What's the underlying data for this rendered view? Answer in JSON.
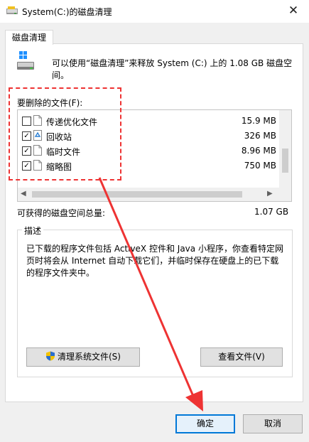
{
  "window": {
    "title": "System(C:)的磁盘清理",
    "close_glyph": "✕"
  },
  "tab": {
    "label": "磁盘清理"
  },
  "intro": {
    "text": "可以使用“磁盘清理”来释放 System (C:) 上的 1.08 GB 磁盘空间。"
  },
  "files": {
    "label": "要删除的文件(F):",
    "items": [
      {
        "name": "传递优化文件",
        "size": "15.9 MB",
        "checked": false,
        "icon": "file-icon"
      },
      {
        "name": "回收站",
        "size": "326 MB",
        "checked": true,
        "icon": "recycle-bin-icon"
      },
      {
        "name": "临时文件",
        "size": "8.96 MB",
        "checked": true,
        "icon": "file-icon"
      },
      {
        "name": "缩略图",
        "size": "750 MB",
        "checked": true,
        "icon": "file-icon"
      }
    ]
  },
  "total": {
    "label": "可获得的磁盘空间总量:",
    "value": "1.07 GB"
  },
  "description": {
    "title": "描述",
    "text": "已下载的程序文件包括 ActiveX 控件和 Java 小程序，你查看特定网页时将会从 Internet 自动下载它们，并临时保存在硬盘上的已下载的程序文件夹中。"
  },
  "buttons": {
    "clean_system": "清理系统文件(S)",
    "view_files": "查看文件(V)",
    "ok": "确定",
    "cancel": "取消"
  },
  "colors": {
    "annotation": "#ee3333",
    "focus": "#0078d7"
  }
}
